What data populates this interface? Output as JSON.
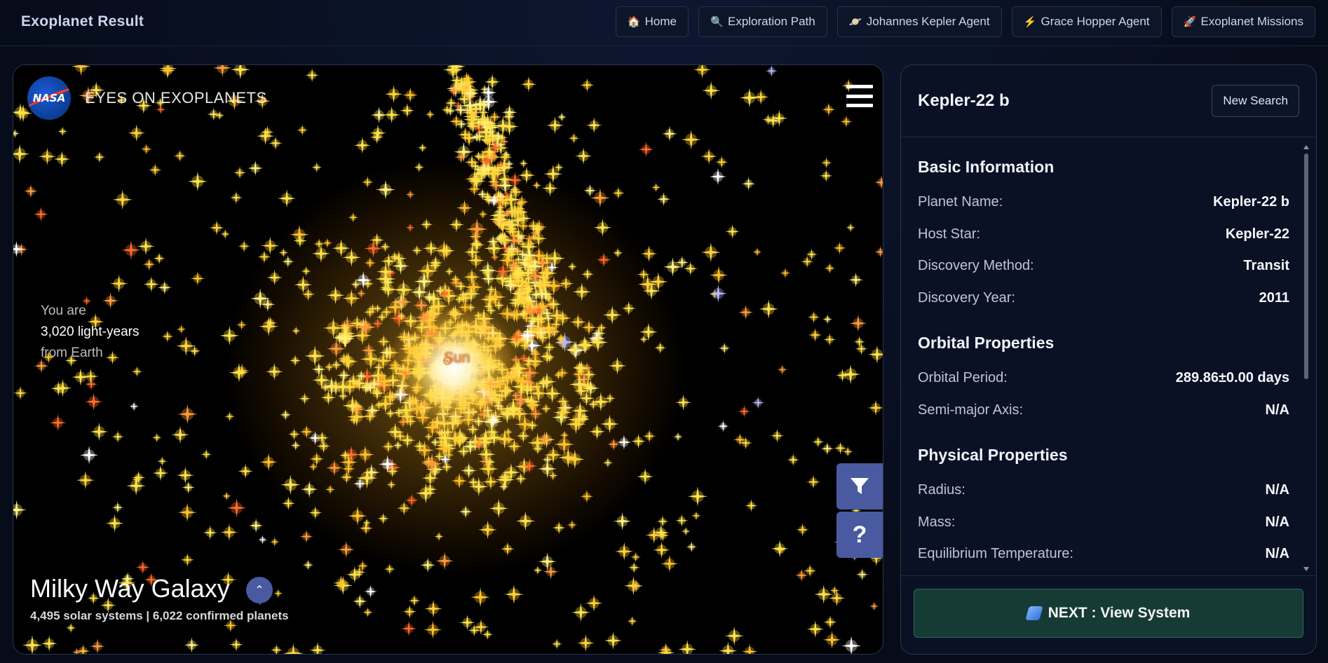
{
  "app": {
    "title": "Exoplanet Result"
  },
  "nav": [
    {
      "label": "Home",
      "icon": "home-icon",
      "glyph": "🏠"
    },
    {
      "label": "Exploration Path",
      "icon": "magnifier-icon",
      "glyph": "🔍"
    },
    {
      "label": "Johannes Kepler Agent",
      "icon": "planet-icon",
      "glyph": "🪐"
    },
    {
      "label": "Grace Hopper Agent",
      "icon": "lightning-icon",
      "glyph": "⚡"
    },
    {
      "label": "Exoplanet Missions",
      "icon": "rocket-icon",
      "glyph": "🚀"
    }
  ],
  "viewer": {
    "brand": "NASA",
    "title": "EYES ON EXOPLANETS",
    "distance": {
      "line1": "You are",
      "line2": "3,020 light-years",
      "line3": "from Earth"
    },
    "sun_label": "Sun",
    "help_glyph": "?",
    "galaxy_title": "Milky Way Galaxy",
    "galaxy_stats": "4,495 solar systems | 6,022 confirmed planets",
    "expand_glyph": "⌃"
  },
  "panel": {
    "planet_name": "Kepler-22 b",
    "new_search_label": "New Search",
    "sections": {
      "basic": {
        "title": "Basic Information",
        "rows": [
          {
            "key": "Planet Name:",
            "value": "Kepler-22 b"
          },
          {
            "key": "Host Star:",
            "value": "Kepler-22"
          },
          {
            "key": "Discovery Method:",
            "value": "Transit"
          },
          {
            "key": "Discovery Year:",
            "value": "2011"
          }
        ]
      },
      "orbital": {
        "title": "Orbital Properties",
        "rows": [
          {
            "key": "Orbital Period:",
            "value": "289.86±0.00 days"
          },
          {
            "key": "Semi-major Axis:",
            "value": "N/A"
          }
        ]
      },
      "physical": {
        "title": "Physical Properties",
        "rows": [
          {
            "key": "Radius:",
            "value": "N/A"
          },
          {
            "key": "Mass:",
            "value": "N/A"
          },
          {
            "key": "Equilibrium Temperature:",
            "value": "N/A"
          }
        ]
      }
    },
    "next_label": "NEXT : View System"
  },
  "colors": {
    "background": "#070c1a",
    "panel": "#0a1124",
    "accent_tool": "#4a5aa0",
    "next_button": "#163a34",
    "sun_label": "#ff9a4a"
  }
}
